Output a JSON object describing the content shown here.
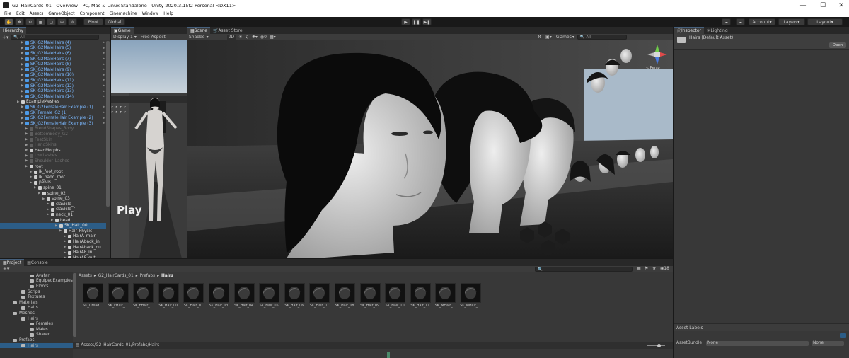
{
  "window": {
    "title": "G2_HairCards_01 - Overview - PC, Mac & Linux Standalone - Unity 2020.3.15f2 Personal <DX11>",
    "min_icon": "minimize-icon",
    "max_icon": "maximize-icon",
    "close_icon": "close-icon"
  },
  "menu": [
    "File",
    "Edit",
    "Assets",
    "GameObject",
    "Component",
    "Cinemachine",
    "Window",
    "Help"
  ],
  "toolbar": {
    "pivot": "Pivot",
    "global": "Global",
    "account": "Account",
    "layers": "Layers",
    "layout": "Layout"
  },
  "hierarchy": {
    "tab": "Hierarchy",
    "search_placeholder": "All",
    "rows": [
      {
        "label": "SK_G2MaleHairs (4)",
        "indent": 1,
        "style": "blue"
      },
      {
        "label": "SK_G2MaleHairs (5)",
        "indent": 1,
        "style": "blue"
      },
      {
        "label": "SK_G2MaleHairs (6)",
        "indent": 1,
        "style": "blue"
      },
      {
        "label": "SK_G2MaleHairs (7)",
        "indent": 1,
        "style": "blue"
      },
      {
        "label": "SK_G2MaleHairs (8)",
        "indent": 1,
        "style": "blue"
      },
      {
        "label": "SK_G2MaleHairs (9)",
        "indent": 1,
        "style": "blue"
      },
      {
        "label": "SK_G2MaleHairs (10)",
        "indent": 1,
        "style": "blue"
      },
      {
        "label": "SK_G2MaleHairs (11)",
        "indent": 1,
        "style": "blue"
      },
      {
        "label": "SK_G2MaleHairs (12)",
        "indent": 1,
        "style": "blue"
      },
      {
        "label": "SK_G2MaleHairs (13)",
        "indent": 1,
        "style": "blue"
      },
      {
        "label": "SK_G2MaleHairs (14)",
        "indent": 1,
        "style": "blue"
      },
      {
        "label": "ExampleMeshes",
        "indent": 0,
        "style": "white"
      },
      {
        "label": "SK_G2FemaleHair Example (1)",
        "indent": 1,
        "style": "blue"
      },
      {
        "label": "SK_Female_G2 (1)",
        "indent": 1,
        "style": "blue"
      },
      {
        "label": "SK_G2FemaleHair Example (2)",
        "indent": 1,
        "style": "blue"
      },
      {
        "label": "SK_G2FemaleHair Example (3)",
        "indent": 1,
        "style": "blue"
      },
      {
        "label": "BlendShapes_Body",
        "indent": 2,
        "style": "dim"
      },
      {
        "label": "BottomBody_G2",
        "indent": 2,
        "style": "dim"
      },
      {
        "label": "FeetSkin",
        "indent": 2,
        "style": "dim"
      },
      {
        "label": "HandSkins",
        "indent": 2,
        "style": "dim"
      },
      {
        "label": "HeadMorphs",
        "indent": 2,
        "style": "white"
      },
      {
        "label": "LowLashes",
        "indent": 2,
        "style": "dim"
      },
      {
        "label": "Shoulder_Lashes",
        "indent": 2,
        "style": "dim"
      },
      {
        "label": "root",
        "indent": 2,
        "style": "white"
      },
      {
        "label": "ik_foot_root",
        "indent": 3,
        "style": "white"
      },
      {
        "label": "ik_hand_root",
        "indent": 3,
        "style": "white"
      },
      {
        "label": "pelvis",
        "indent": 3,
        "style": "white"
      },
      {
        "label": "spine_01",
        "indent": 4,
        "style": "white"
      },
      {
        "label": "spine_02",
        "indent": 5,
        "style": "white"
      },
      {
        "label": "spine_03",
        "indent": 6,
        "style": "white"
      },
      {
        "label": "clavicle_l",
        "indent": 7,
        "style": "white"
      },
      {
        "label": "clavicle_r",
        "indent": 7,
        "style": "white"
      },
      {
        "label": "neck_01",
        "indent": 7,
        "style": "white"
      },
      {
        "label": "head",
        "indent": 8,
        "style": "white"
      },
      {
        "label": "SK_Hair_00",
        "indent": 9,
        "style": "white"
      },
      {
        "label": "Hair_Physic",
        "indent": 10,
        "style": "white"
      },
      {
        "label": "HairA_main",
        "indent": 11,
        "style": "white"
      },
      {
        "label": "HairAback_in",
        "indent": 11,
        "style": "white"
      },
      {
        "label": "HairAback_ou",
        "indent": 11,
        "style": "white"
      },
      {
        "label": "HairAF_in",
        "indent": 11,
        "style": "white"
      },
      {
        "label": "HairAF_out",
        "indent": 11,
        "style": "white"
      }
    ]
  },
  "game": {
    "tab": "Game",
    "display": "Display 1",
    "aspect": "Free Aspect",
    "overlay_text": "Play"
  },
  "scene": {
    "tabs": [
      "Scene",
      "Asset Store"
    ],
    "shading": "Shaded",
    "mode_2d": "2D",
    "gizmos": "Gizmos",
    "search_placeholder": "All",
    "gizmo_label": "< Persp"
  },
  "inspector": {
    "tabs": [
      "Inspector",
      "Lighting"
    ],
    "asset_name": "Hairs (Default Asset)",
    "open_button": "Open",
    "asset_labels": "Asset Labels",
    "asset_bundle_label": "AssetBundle",
    "asset_bundle_value": "None",
    "asset_variant_value": "None"
  },
  "project": {
    "tabs": [
      "Project",
      "Console"
    ],
    "tree": [
      {
        "label": "Avatar",
        "indent": 3
      },
      {
        "label": "EquipedExamples",
        "indent": 3
      },
      {
        "label": "Floors",
        "indent": 3
      },
      {
        "label": "Scrips",
        "indent": 2
      },
      {
        "label": "Textures",
        "indent": 2
      },
      {
        "label": "Materials",
        "indent": 1
      },
      {
        "label": "Hairs",
        "indent": 2
      },
      {
        "label": "Meshes",
        "indent": 1
      },
      {
        "label": "Hairs",
        "indent": 2
      },
      {
        "label": "Females",
        "indent": 3
      },
      {
        "label": "Males",
        "indent": 3
      },
      {
        "label": "Shared",
        "indent": 3
      },
      {
        "label": "Prefabs",
        "indent": 1
      },
      {
        "label": "Hairs",
        "indent": 2,
        "selected": true
      }
    ],
    "breadcrumb": [
      "Assets",
      "G2_HairCards_01",
      "Prefabs",
      "Hairs"
    ],
    "hidden_count": "18",
    "assets": [
      "SK_Dread...",
      "SK_FHair_...",
      "SK_FHair_...",
      "SK_Hair_00",
      "SK_Hair_01",
      "SK_Hair_03",
      "SK_Hair_04",
      "SK_Hair_05",
      "SK_Hair_06",
      "SK_Hair_07",
      "SK_Hair_08",
      "SK_Hair_09",
      "SK_Hair_10",
      "SK_Hair_11",
      "SK_MHair_...",
      "SK_MHair_..."
    ],
    "path": "Assets/G2_HairCards_01/Prefabs/Hairs"
  },
  "colors": {
    "accent": "#46607c",
    "selection": "#2c5d87",
    "blue_prefab": "#7ab8ff"
  }
}
